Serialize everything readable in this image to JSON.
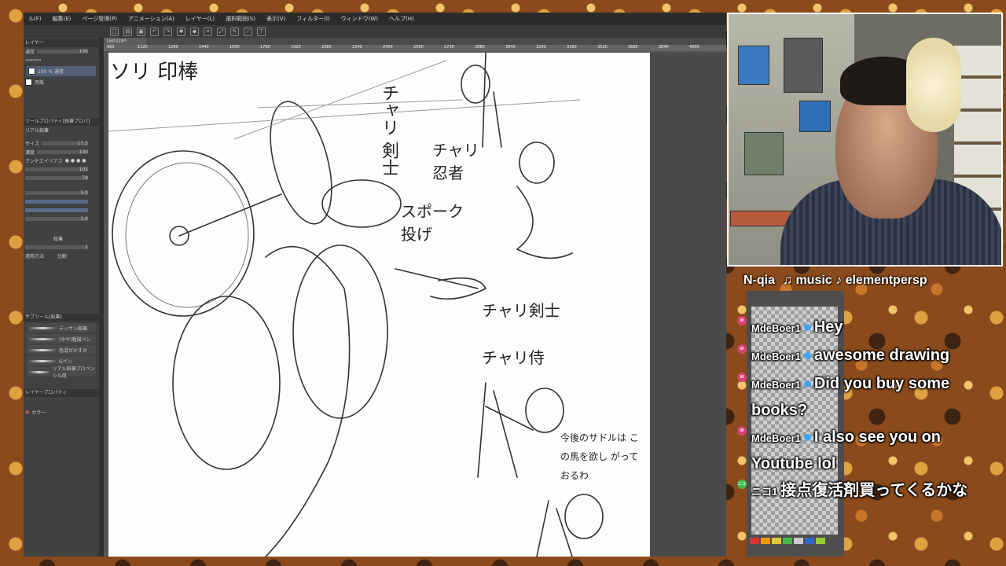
{
  "app": {
    "menu": [
      "ル(F)",
      "編集(E)",
      "ページ管理(P)",
      "アニメーション(A)",
      "レイヤー(L)",
      "選択範囲(S)",
      "表示(V)",
      "フィルター(I)",
      "ウィンドウ(W)",
      "ヘルプ(H)"
    ],
    "tab_label": "160328*",
    "ruler_ticks": [
      "960",
      "1120",
      "1280",
      "1440",
      "1600",
      "1760",
      "1920",
      "2080",
      "2240",
      "2400",
      "2560",
      "2720",
      "2880",
      "3040",
      "3200",
      "3360",
      "3520",
      "3680",
      "3840",
      "4000"
    ],
    "left_panel": {
      "layer_header": "レイヤー",
      "blend_mode": "通常",
      "opacity_value": "100",
      "layers": [
        {
          "name": "100 % 通常",
          "sub": "レイヤー"
        },
        {
          "name": "用紙"
        }
      ],
      "tool_property_header": "ツールプロパティ[鉛筆プロパ]",
      "tool_property_name": "リアル鉛筆",
      "size_label": "サイズ",
      "size_value": "17.5",
      "density_label": "濃度",
      "density_value": "100",
      "antialias_label": "アンチエイリアス",
      "value_101": "101",
      "value_79": "79",
      "value_50": "5.0",
      "value_10": "1.0",
      "pencil_label": "鉛筆",
      "value_1": "1",
      "method_label": "適用方法",
      "method_value": "比較",
      "brush_tab": "サブツール[鉛筆]",
      "brushes": [
        "デッサン鉛筆",
        "(やや)粗描ペン",
        "色混ぜかすか",
        "Gペン",
        "リアル鉛筆プロペンシル用"
      ],
      "layer_prop": "レイヤープロパティ",
      "color_label": "カラー"
    }
  },
  "canvas_text": {
    "t1": "ソリ 印棒",
    "t2": "チャリ 剣士",
    "t3": "チャリ 忍者",
    "t4": "スポーク 投げ",
    "t5": "チャリ剣士",
    "t6": "チャリ侍",
    "t7": "今後のサドルは この馬を欲し がっておるわ"
  },
  "stream": {
    "overlay_name": "N-qia",
    "music_label": "♫ music ♪ elementpersp",
    "chat": [
      {
        "badge": "M",
        "badge_color": "#d8436f",
        "user": "MdeBoer1",
        "text": "Hey"
      },
      {
        "badge": "M",
        "badge_color": "#d8436f",
        "user": "MdeBoer1",
        "text": "awesome drawing"
      },
      {
        "badge": "M",
        "badge_color": "#d8436f",
        "user": "MdeBoer1",
        "text": "Did you buy some books?"
      },
      {
        "badge": "M",
        "badge_color": "#d8436f",
        "user": "MdeBoer1",
        "text": "I also see you on Youtube lol"
      },
      {
        "badge": "ニコ",
        "badge_color": "#3fb950",
        "user": "ニコ1",
        "text": "接点復活剤買ってくるかな"
      }
    ]
  },
  "colors": {
    "ui_dark": "#4a4a4a",
    "canvas": "#fdfdfd",
    "accent": "#3ea6ff"
  }
}
